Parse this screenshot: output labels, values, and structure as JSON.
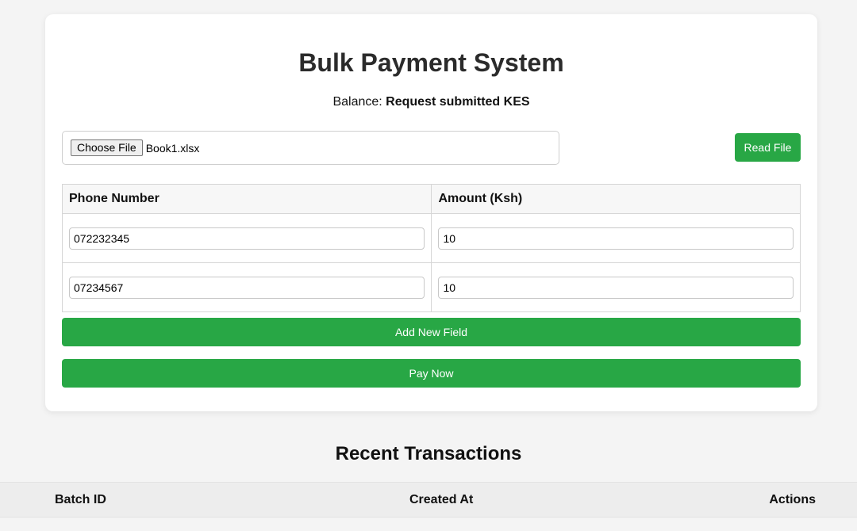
{
  "form": {
    "title": "Bulk Payment System",
    "balance_label": "Balance:",
    "balance_value": "Request submitted KES",
    "file_button_label": "Choose File",
    "file_name": "Book1.xlsx",
    "read_file_label": "Read File",
    "columns": [
      "Phone Number",
      "Amount (Ksh)"
    ],
    "rows": [
      {
        "phone": "072232345",
        "amount": "10"
      },
      {
        "phone": "07234567",
        "amount": "10"
      }
    ],
    "add_field_label": "Add New Field",
    "pay_now_label": "Pay Now"
  },
  "transactions": {
    "title": "Recent Transactions",
    "columns": [
      "Batch ID",
      "Created At",
      "Actions"
    ]
  },
  "colors": {
    "accent": "#28a745",
    "background": "#f4f4f4"
  }
}
